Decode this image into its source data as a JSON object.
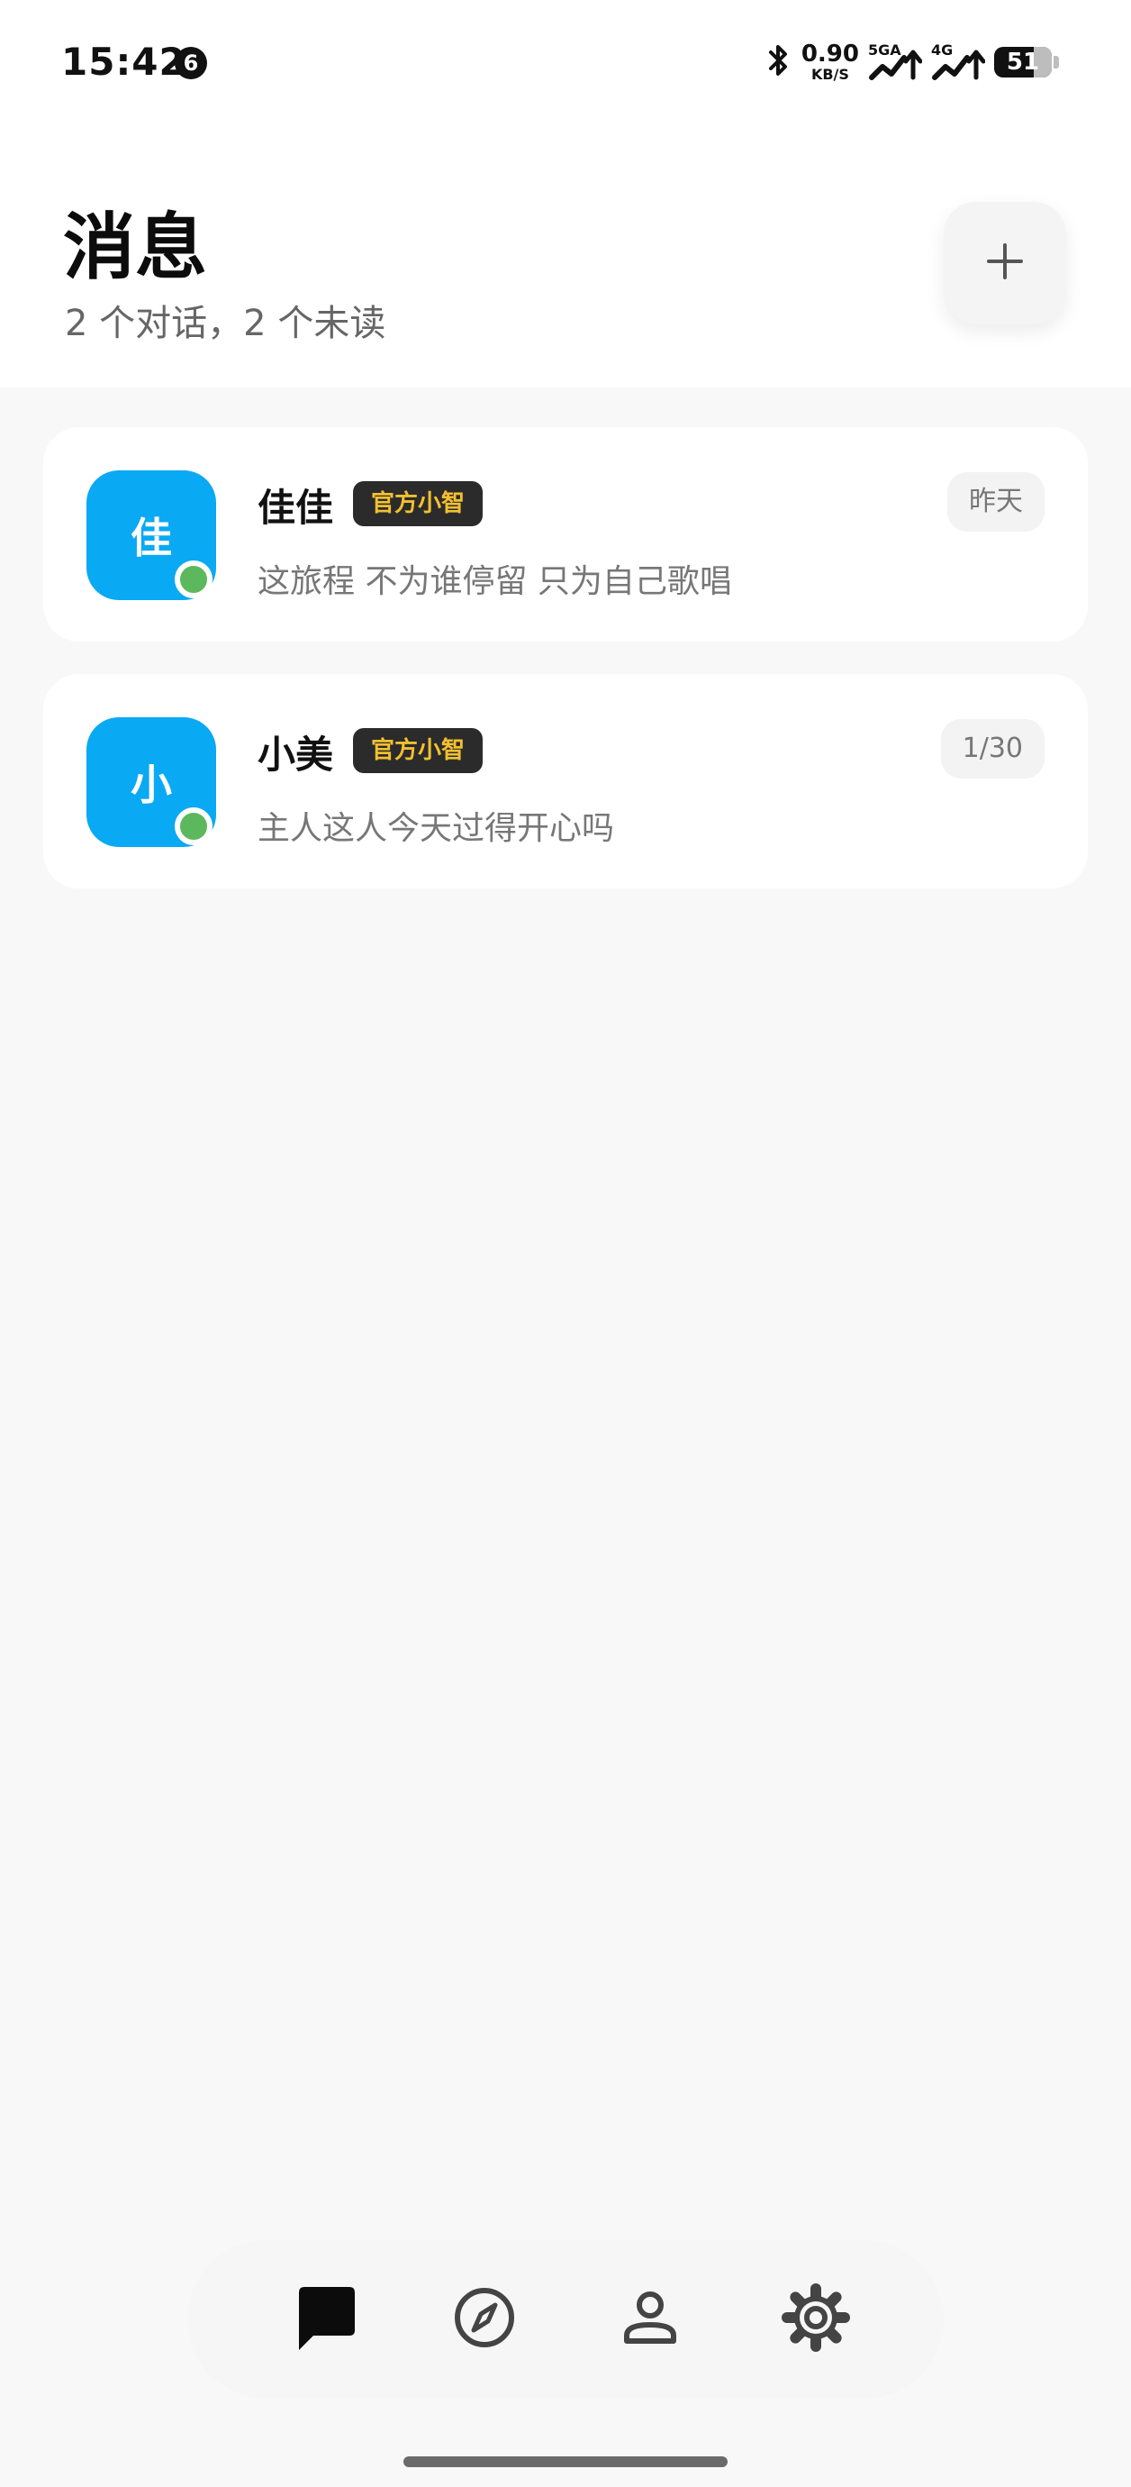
{
  "status_bar": {
    "time": "15:42",
    "notification_count": "6",
    "net_speed_value": "0.90",
    "net_speed_unit": "KB/S",
    "signal_1_label": "5GA",
    "signal_2_label": "4G",
    "battery_level": "51"
  },
  "header": {
    "title": "消息",
    "subtitle": "2 个对话，2 个未读",
    "add_icon": "plus-icon"
  },
  "conversations": [
    {
      "avatar_char": "佳",
      "name": "佳佳",
      "tag": "官方小智",
      "time": "昨天",
      "preview": "这旅程 不为谁停留 只为自己歌唱",
      "online": true
    },
    {
      "avatar_char": "小",
      "name": "小美",
      "tag": "官方小智",
      "time": "1/30",
      "preview": "主人这人今天过得开心吗",
      "online": true
    }
  ],
  "bottom_nav": [
    {
      "icon": "chat-bubble-icon",
      "active": true
    },
    {
      "icon": "compass-icon",
      "active": false
    },
    {
      "icon": "person-icon",
      "active": false
    },
    {
      "icon": "gear-icon",
      "active": false
    }
  ],
  "colors": {
    "avatar": "#0aa9f3",
    "online": "#5cb85c",
    "tag_bg": "#2b2b2b",
    "tag_text": "#f2c030",
    "page_bg": "#f8f8f8"
  }
}
